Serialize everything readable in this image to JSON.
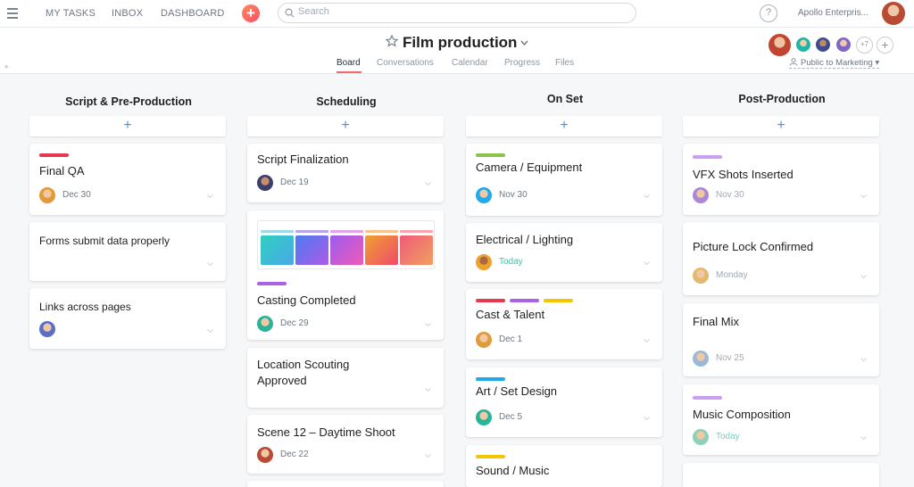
{
  "topbar": {
    "nav": [
      "MY TASKS",
      "INBOX",
      "DASHBOARD"
    ],
    "search_placeholder": "Search",
    "help_label": "?",
    "org_name": "Apollo Enterpris..."
  },
  "project": {
    "title": "Film production",
    "tabs": [
      "Board",
      "Conversations",
      "Calendar",
      "Progress",
      "Files"
    ],
    "active_tab": "Board",
    "member_overflow": "+7",
    "add_member_label": "+",
    "privacy": "Public to Marketing"
  },
  "colors": {
    "accent_red": "#f06a6a",
    "today_green": "#37c5ab",
    "add_plus_blue": "#4a90d9"
  },
  "columns": [
    {
      "title": "Script & Pre-Production",
      "add_label": "+",
      "cards": [
        {
          "title": "Final QA",
          "tags": [
            "#e8384f"
          ],
          "due": "Dec 30"
        },
        {
          "title": "Forms submit data properly",
          "due": ""
        },
        {
          "title": "Links across pages",
          "due": ""
        }
      ]
    },
    {
      "title": "Scheduling",
      "add_label": "+",
      "cards": [
        {
          "title": "Script Finalization",
          "due": "Dec 19"
        },
        {
          "title": "Casting Completed",
          "tags": [
            "#aa62e3"
          ],
          "due": "Dec 29",
          "has_image": true
        },
        {
          "title": "Location Scouting Approved",
          "due": ""
        },
        {
          "title": "Scene 12 – Daytime Shoot",
          "due": "Dec 22"
        }
      ]
    },
    {
      "title": "On Set",
      "add_label": "+",
      "cards": [
        {
          "title": "Camera / Equipment",
          "tags": [
            "#8bc34a"
          ],
          "due": "Nov 30"
        },
        {
          "title": "Electrical / Lighting",
          "due": "Today"
        },
        {
          "title": "Cast & Talent",
          "tags": [
            "#e8384f",
            "#aa62e3",
            "#f2c600"
          ],
          "due": "Dec 1"
        },
        {
          "title": "Art / Set Design",
          "tags": [
            "#20aaea"
          ],
          "due": "Dec 5"
        },
        {
          "title": "Sound / Music",
          "tags": [
            "#f2c600"
          ],
          "due": ""
        }
      ]
    },
    {
      "title": "Post-Production",
      "add_label": "+",
      "cards": [
        {
          "title": "VFX Shots Inserted",
          "tags": [
            "#c9a0f0"
          ],
          "due": "Nov 30"
        },
        {
          "title": "Picture Lock Confirmed",
          "due": "Monday"
        },
        {
          "title": "Final Mix",
          "due": "Nov 25"
        },
        {
          "title": "Music Composition",
          "tags": [
            "#c9a0f0"
          ],
          "due": "Today"
        }
      ]
    }
  ]
}
